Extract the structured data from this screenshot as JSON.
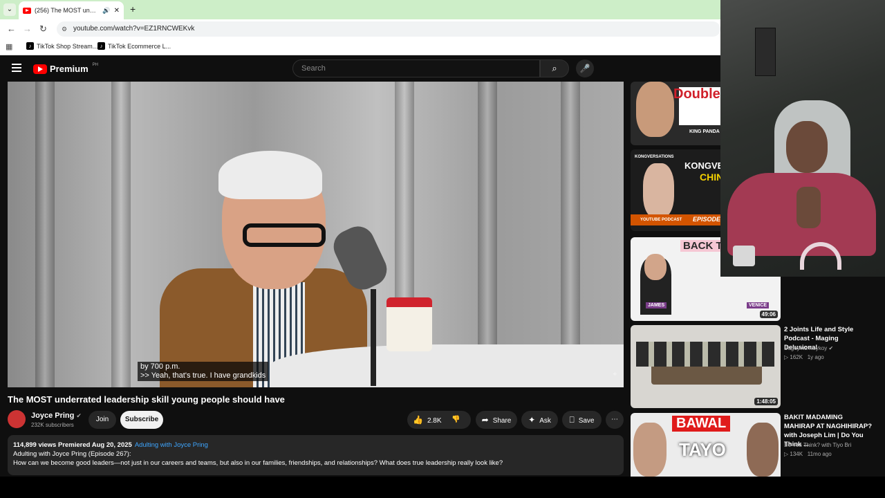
{
  "browser": {
    "tab_title": "(256) The MOST underrated l...",
    "url": "youtube.com/watch?v=EZ1RNCWEKvk",
    "bookmarks": [
      "TikTok Shop Stream...",
      "TikTok Ecommerce L..."
    ]
  },
  "youtube": {
    "logo": "Premium",
    "region": "PH",
    "search_placeholder": "Search"
  },
  "video": {
    "caption_line1": "by 700 p.m.",
    "caption_line2": ">> Yeah, that's true. I have grandkids",
    "title": "The MOST underrated leadership skill young people should have",
    "channel": "Joyce Pring",
    "subscribers": "232K subscribers",
    "join_label": "Join",
    "subscribe_label": "Subscribe",
    "likes": "2.8K",
    "share_label": "Share",
    "ask_label": "Ask",
    "save_label": "Save"
  },
  "description": {
    "stats": "114,899 views  Premiered Aug 20, 2025",
    "playlist": "Adulting with Joyce Pring",
    "line1": "Adulting with Joyce Pring (Episode 267):",
    "line2": "How can we become good leaders—not just in our careers and teams, but also in our families, friendships, and relationships? What does true leadership really look like?"
  },
  "recommendations": [
    {
      "thumb_text": "Double My Inco",
      "thumb_sub": "KING PANDA"
    },
    {
      "thumb_text": "KONGVERSA",
      "thumb_sub": "EPISODE 5",
      "thumb_top": "KONGVERSATIONS",
      "thumb_mid": "CHINKEE",
      "thumb_small": "YOUTUBE PODCAST"
    },
    {
      "thumb_text": "BACK TO R",
      "duration": "49:06",
      "thumb_sub": "JAMES",
      "thumb_sub2": "VENICE"
    },
    {
      "title": "2 Joints Life and Style Podcast - Maging Delusional",
      "channel": "Bugoy na Koykoy",
      "views": "162K",
      "age": "1y ago",
      "duration": "1:48:05"
    },
    {
      "title": "BAKIT MADAMING MAHIRAP AT NAGHIHIRAP? with Joseph Lim | Do You Think ...",
      "channel": "Do You Think? with Tiyo Bri",
      "views": "134K",
      "age": "11mo ago",
      "thumb_text": "BAWAL",
      "thumb_text2": "TAYO"
    }
  ]
}
